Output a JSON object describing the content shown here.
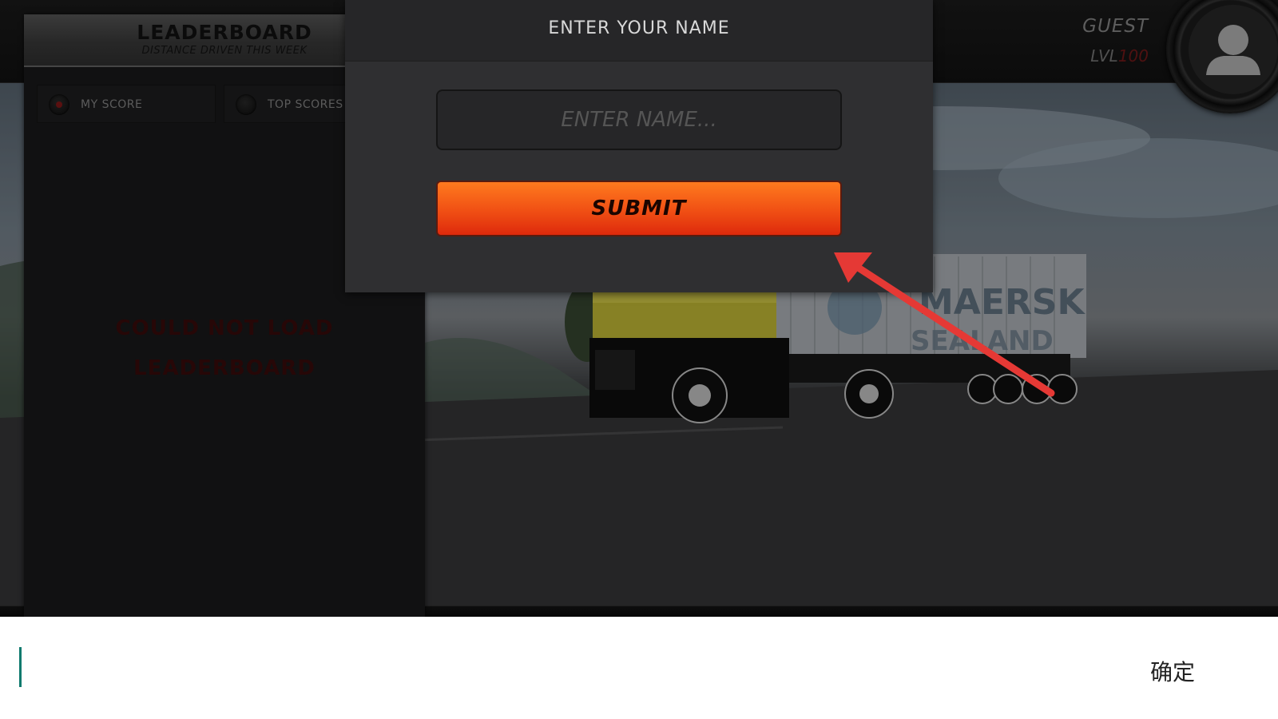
{
  "leaderboard": {
    "title": "LEADERBOARD",
    "subtitle": "DISTANCE DRIVEN THIS WEEK",
    "tabs": [
      {
        "label": "MY SCORE",
        "selected": true
      },
      {
        "label": "TOP SCORES",
        "selected": false
      }
    ],
    "error_line1": "COULD NOT LOAD",
    "error_line2": "LEADERBOARD"
  },
  "profile": {
    "name": "GUEST",
    "level_prefix": "LVL",
    "level_value": "100",
    "avatar_icon": "user-silhouette-icon"
  },
  "dialog": {
    "title": "ENTER YOUR NAME",
    "name_placeholder": "ENTER NAME...",
    "name_value": "",
    "submit_label": "SUBMIT"
  },
  "scene": {
    "trailer_text_1": "MAERSK",
    "trailer_text_2": "SEALAND"
  },
  "annotation": {
    "arrow_color": "#e53935",
    "points_to": "submit-button"
  },
  "ime": {
    "confirm_label": "确定",
    "cursor_color": "#0f7a6e"
  },
  "colors": {
    "submit_top": "#ff7a1e",
    "submit_bottom": "#de2a0c",
    "error_text": "#3c0c0c"
  }
}
